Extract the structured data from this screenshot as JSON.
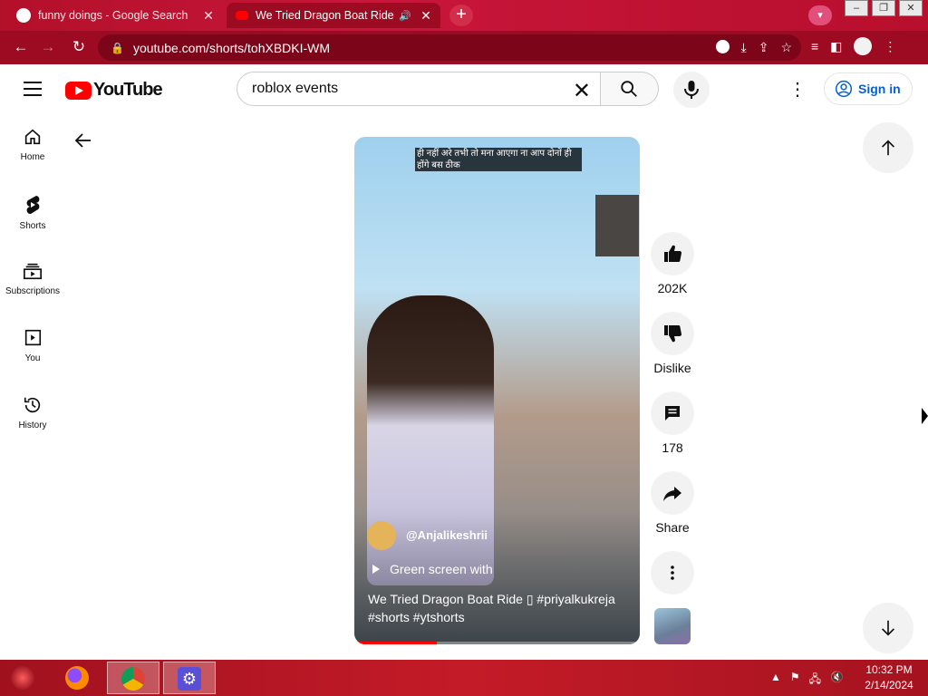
{
  "browser": {
    "tabs": [
      {
        "title": "funny doings - Google Search",
        "active": false
      },
      {
        "title": "We Tried Dragon Boat Ride  ",
        "active": true
      }
    ],
    "url": "youtube.com/shorts/tohXBDKI-WM"
  },
  "youtube": {
    "logo_text": "YouTube",
    "search_value": "roblox events",
    "signin_label": "Sign in",
    "guide": [
      {
        "label": "Home",
        "icon": "home-icon"
      },
      {
        "label": "Shorts",
        "icon": "shorts-icon"
      },
      {
        "label": "Subscriptions",
        "icon": "subscriptions-icon"
      },
      {
        "label": "You",
        "icon": "you-icon"
      },
      {
        "label": "History",
        "icon": "history-icon"
      }
    ]
  },
  "short": {
    "caption": "ही नहीं अरे तभी तो मना आएगा ना आप दोनों ही होंगे बस ठीक",
    "channel": "@Anjalikeshrii",
    "sound": "Green screen with",
    "title": "We Tried Dragon Boat Ride ▯ #priyalkukreja #shorts #ytshorts",
    "progress": 0.29,
    "likes": "202K",
    "dislike_label": "Dislike",
    "comments": "178",
    "share_label": "Share"
  },
  "taskbar": {
    "time": "10:32 PM",
    "date": "2/14/2024"
  },
  "colors": {
    "brand_red": "#ff0000",
    "link_blue": "#065fd4",
    "chrome_red": "#9c0b22"
  }
}
